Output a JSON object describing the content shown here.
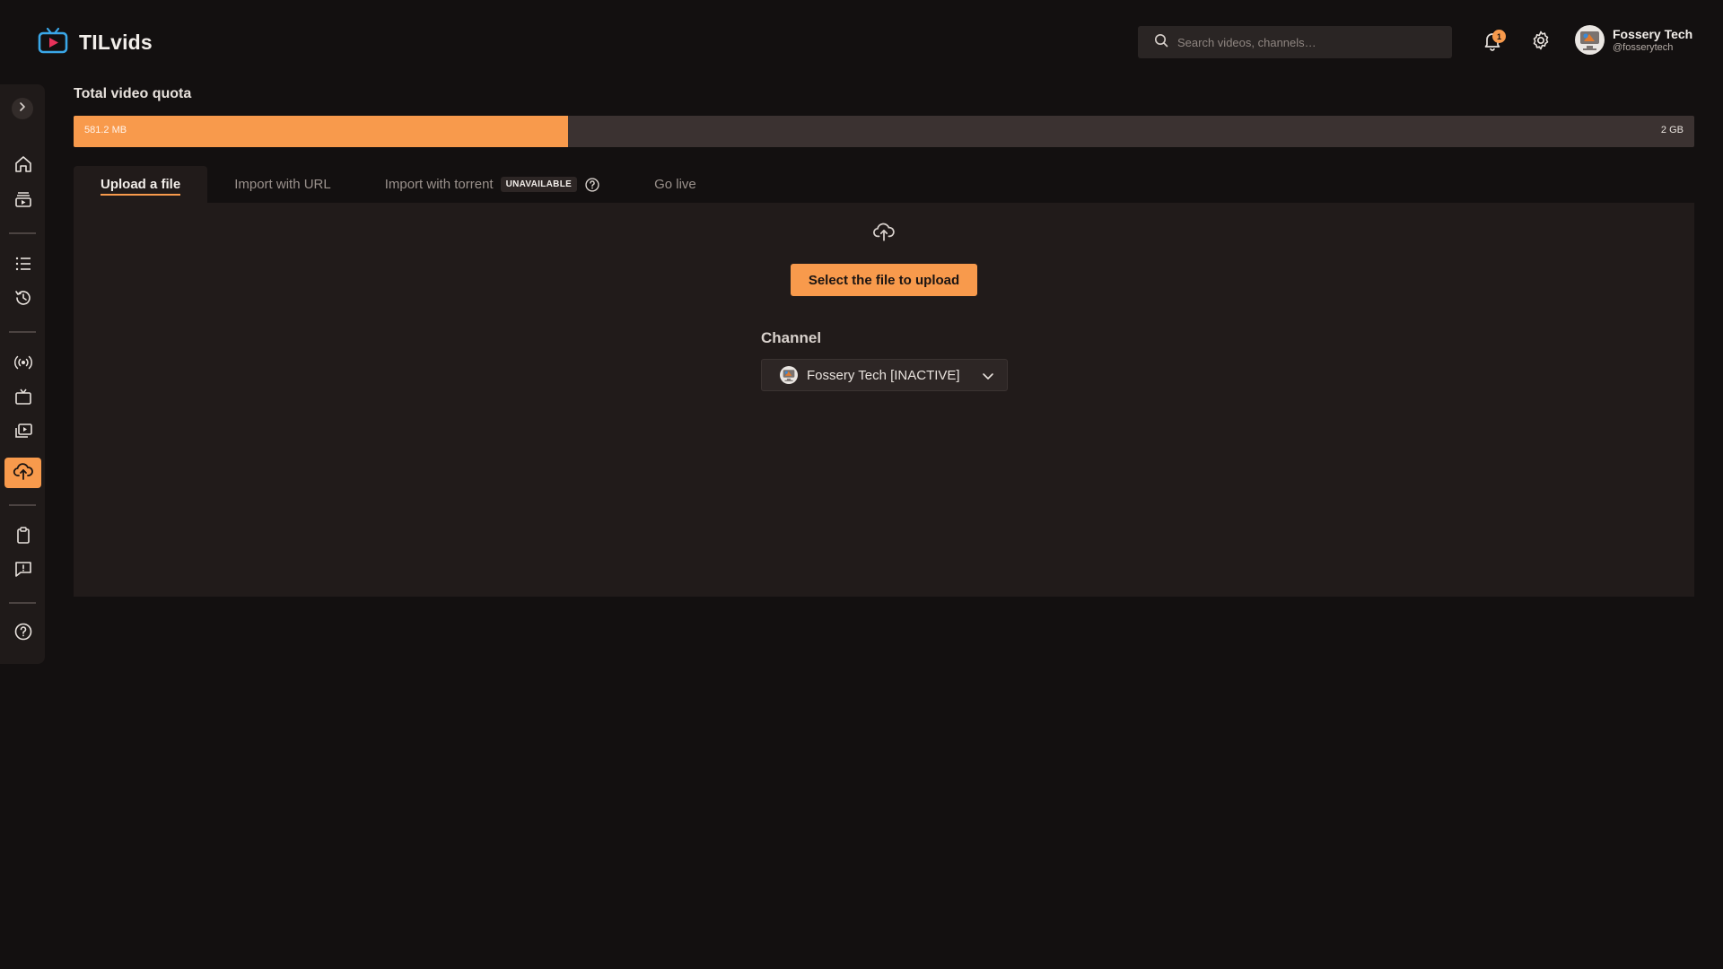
{
  "app": {
    "title": "TILvids",
    "accent": "#f89a4c"
  },
  "search": {
    "placeholder": "Search videos, channels…"
  },
  "notifications": {
    "count": "1"
  },
  "user": {
    "name": "Fossery Tech",
    "handle": "@fosserytech"
  },
  "sidebar": {
    "items": [
      {
        "icon": "home-icon"
      },
      {
        "icon": "subscriptions-icon"
      },
      {
        "icon": "playlists-icon"
      },
      {
        "icon": "history-icon"
      },
      {
        "icon": "live-broadcast-icon"
      },
      {
        "icon": "channels-tv-icon"
      },
      {
        "icon": "videos-library-icon"
      },
      {
        "icon": "upload-cloud-icon",
        "active": true
      },
      {
        "icon": "clipboard-icon"
      },
      {
        "icon": "feedback-icon"
      },
      {
        "icon": "help-icon"
      }
    ]
  },
  "quota": {
    "title": "Total video quota",
    "used": "581.2 MB",
    "total": "2 GB",
    "used_fraction": 0.305
  },
  "tabs": [
    {
      "label": "Upload a file",
      "active": true
    },
    {
      "label": "Import with URL"
    },
    {
      "label": "Import with torrent",
      "badge": "UNAVAILABLE"
    },
    {
      "label": "Go live"
    }
  ],
  "upload": {
    "button_label": "Select the file to upload",
    "channel_label": "Channel",
    "channel_value": "Fossery Tech [INACTIVE]"
  }
}
